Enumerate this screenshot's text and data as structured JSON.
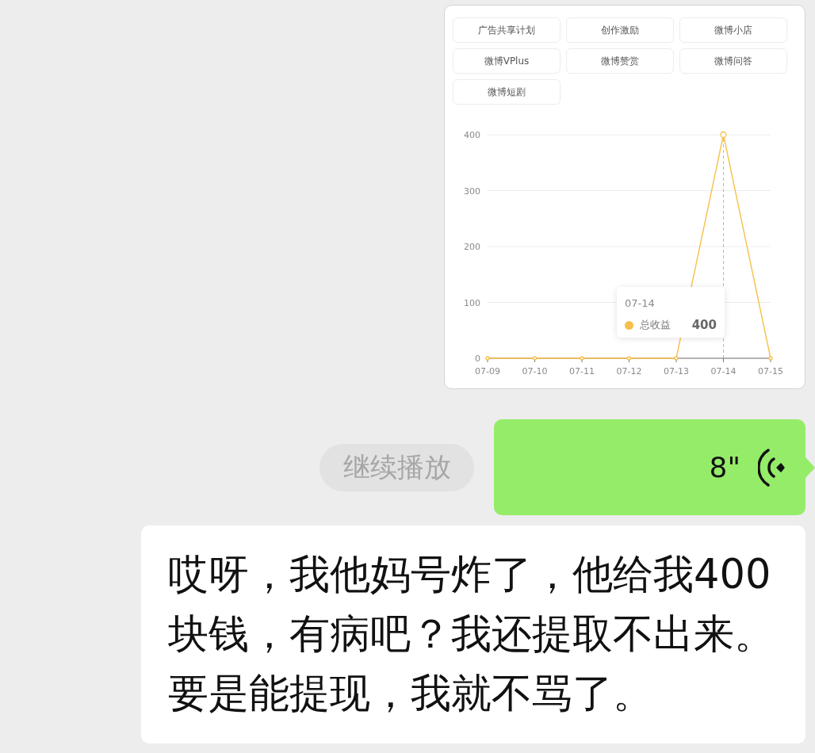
{
  "image_card": {
    "filters": [
      "广告共享计划",
      "创作激励",
      "微博小店",
      "微博VPlus",
      "微博赞赏",
      "微博问答",
      "微博短剧"
    ],
    "chart": {
      "chart_data": {
        "type": "line",
        "categories": [
          "07-09",
          "07-10",
          "07-11",
          "07-12",
          "07-13",
          "07-14",
          "07-15"
        ],
        "series": [
          {
            "name": "总收益",
            "color": "#f7c04a",
            "values": [
              0,
              0,
              0,
              0,
              0,
              400,
              0
            ],
            "marker": "circle"
          }
        ],
        "ylim": [
          0,
          400
        ],
        "yticks": [
          0,
          100,
          200,
          300,
          400
        ],
        "grid": true,
        "ref_lines": [
          {
            "axis": "x",
            "value": "07-14"
          }
        ]
      },
      "tooltip": {
        "label": "07-14",
        "value": "400"
      }
    }
  },
  "voice_message": {
    "continue_button": "继续播放",
    "duration": "8\""
  },
  "text_message": {
    "text": "哎呀，我他妈号炸了，他给我400块钱，有病吧？我还提取不出来。要是能提现，我就不骂了。"
  }
}
